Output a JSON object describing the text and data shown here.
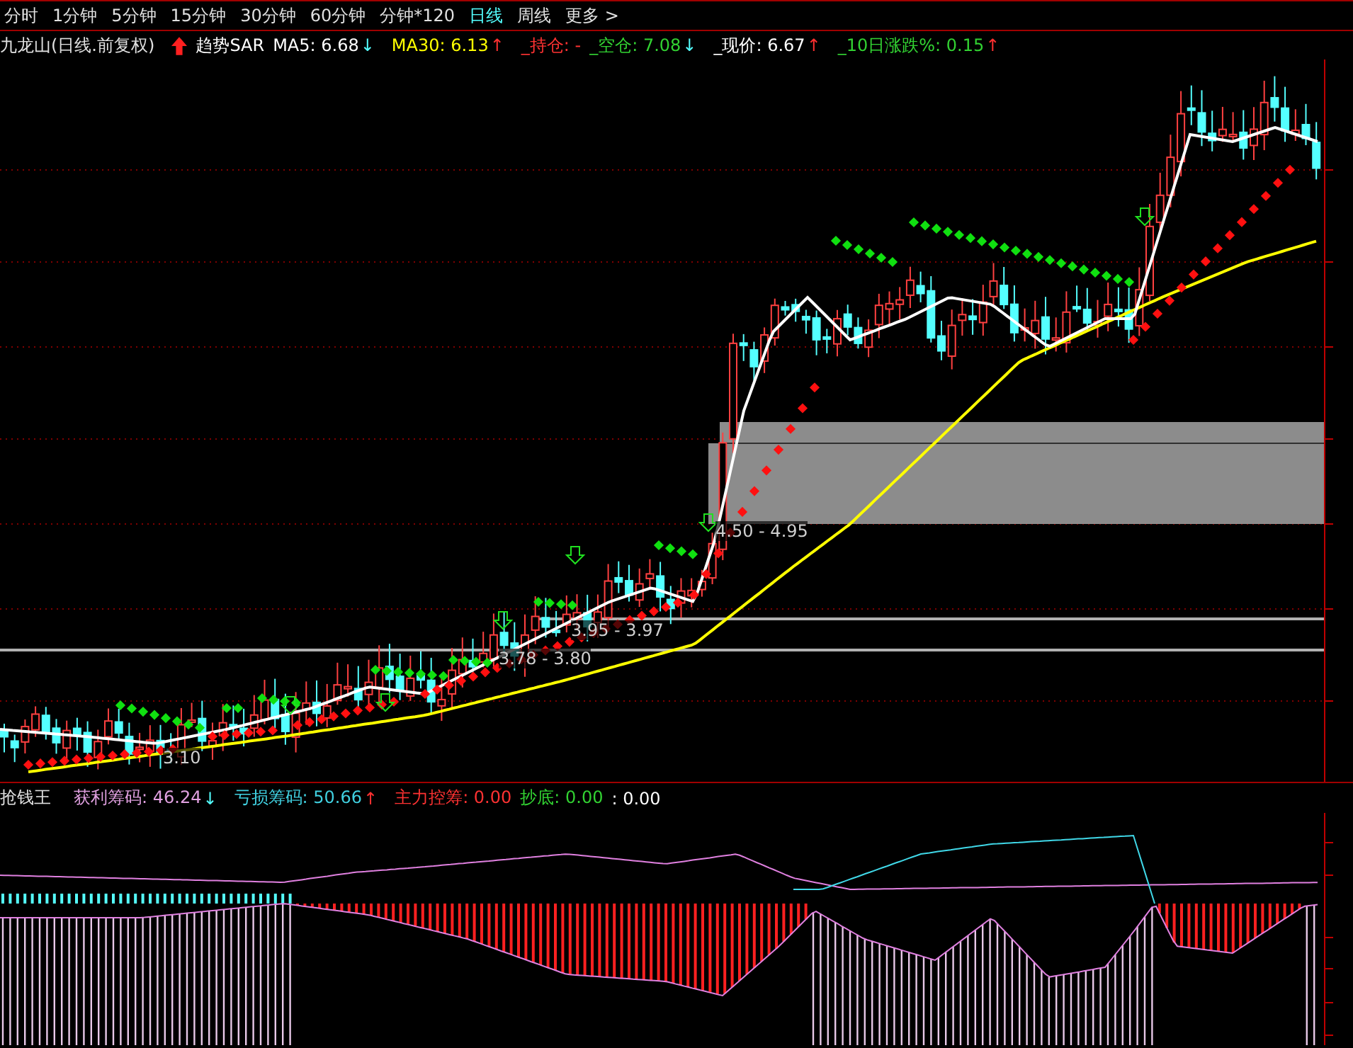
{
  "period_tabs": [
    {
      "label": "分时",
      "selected": false
    },
    {
      "label": "1分钟",
      "selected": false
    },
    {
      "label": "5分钟",
      "selected": false
    },
    {
      "label": "15分钟",
      "selected": false
    },
    {
      "label": "30分钟",
      "selected": false
    },
    {
      "label": "60分钟",
      "selected": false
    },
    {
      "label": "分钟*120",
      "selected": false
    },
    {
      "label": "日线",
      "selected": true
    },
    {
      "label": "周线",
      "selected": false
    },
    {
      "label": "更多 >",
      "selected": false
    }
  ],
  "main_legend": {
    "title": "九龙山(日线.前复权)",
    "items": [
      {
        "kind": "signal",
        "label": "趋势SAR",
        "color": "#ffffff"
      },
      {
        "kind": "value",
        "label": "MA5: 6.68",
        "arrow": "↓",
        "color": "#ffffff"
      },
      {
        "kind": "value",
        "label": "MA30: 6.13",
        "arrow": "↑",
        "color": "#ffff00"
      },
      {
        "kind": "value",
        "label": "_持仓: -",
        "color": "#ff3232"
      },
      {
        "kind": "value",
        "label": "_空仓: 7.08",
        "arrow": "↓",
        "color": "#32d232"
      },
      {
        "kind": "value",
        "label": "_现价: 6.67",
        "arrow": "↑",
        "color": "#ffffff"
      },
      {
        "kind": "value",
        "label": "_10日涨跌%: 0.15",
        "arrow": "↑",
        "color": "#32d232"
      }
    ]
  },
  "price_labels": [
    "4.50 - 4.95",
    "3.95 - 3.97",
    "3.78 - 3.80",
    "3.10"
  ],
  "indicator_legend": {
    "title": "抢钱王",
    "items": [
      {
        "label": "获利筹码: 46.24",
        "arrow": "↓",
        "color": "#e0a0e0"
      },
      {
        "label": "亏损筹码: 50.66",
        "arrow": "↑",
        "color": "#40d0e0"
      },
      {
        "label": "主力控筹: 0.00",
        "color": "#ff3232"
      },
      {
        "label": "抄底: 0.00",
        "color": "#32d232"
      },
      {
        "label": ": 0.00",
        "color": "#ffffff"
      }
    ]
  }
}
